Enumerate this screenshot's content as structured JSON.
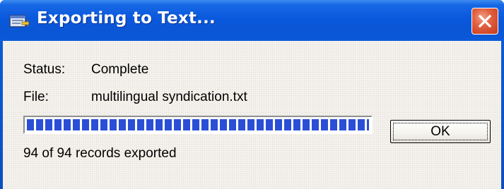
{
  "window": {
    "title": "Exporting to Text...",
    "icons": {
      "title": "export-window-icon",
      "close": "close-icon"
    },
    "close_color": "#d8512f",
    "titlebar_color": "#0a58dc"
  },
  "status": {
    "label": "Status:",
    "value": "Complete"
  },
  "file": {
    "label": "File:",
    "value": "multilingual syndication.txt"
  },
  "progress": {
    "fraction": 1.0,
    "color": "#2a4fd6"
  },
  "records": {
    "text": "94 of 94 records exported"
  },
  "buttons": {
    "ok_label": "OK"
  }
}
